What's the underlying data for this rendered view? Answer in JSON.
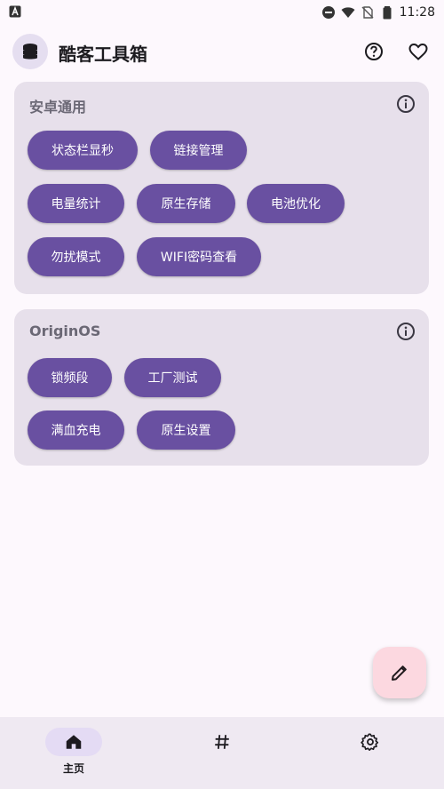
{
  "status_bar": {
    "time": "11:28",
    "icons": [
      "notification-a-icon",
      "dnd-icon",
      "wifi-icon",
      "no-sim-icon",
      "battery-icon"
    ]
  },
  "app_bar": {
    "title": "酷客工具箱",
    "actions": [
      "help-icon",
      "favorite-icon"
    ]
  },
  "sections": [
    {
      "title": "安卓通用",
      "chips": [
        "状态栏显秒",
        "链接管理",
        "电量统计",
        "原生存储",
        "电池优化",
        "勿扰模式",
        "WIFI密码查看"
      ]
    },
    {
      "title": "OriginOS",
      "chips": [
        "锁频段",
        "工厂测试",
        "满血充电",
        "原生设置"
      ]
    }
  ],
  "fab": {
    "icon": "edit-pencil-icon"
  },
  "bottom_nav": {
    "items": [
      {
        "icon": "home-icon",
        "label": "主页",
        "active": true
      },
      {
        "icon": "hash-icon",
        "label": "",
        "active": false
      },
      {
        "icon": "settings-gear-icon",
        "label": "",
        "active": false
      }
    ]
  },
  "colors": {
    "background": "#fdf8fd",
    "card": "#e7e0eb",
    "chip": "#6950a1",
    "fab": "#fcd8e0",
    "nav_bar": "#efe9f2",
    "nav_active_pill": "#e4dbf4"
  }
}
